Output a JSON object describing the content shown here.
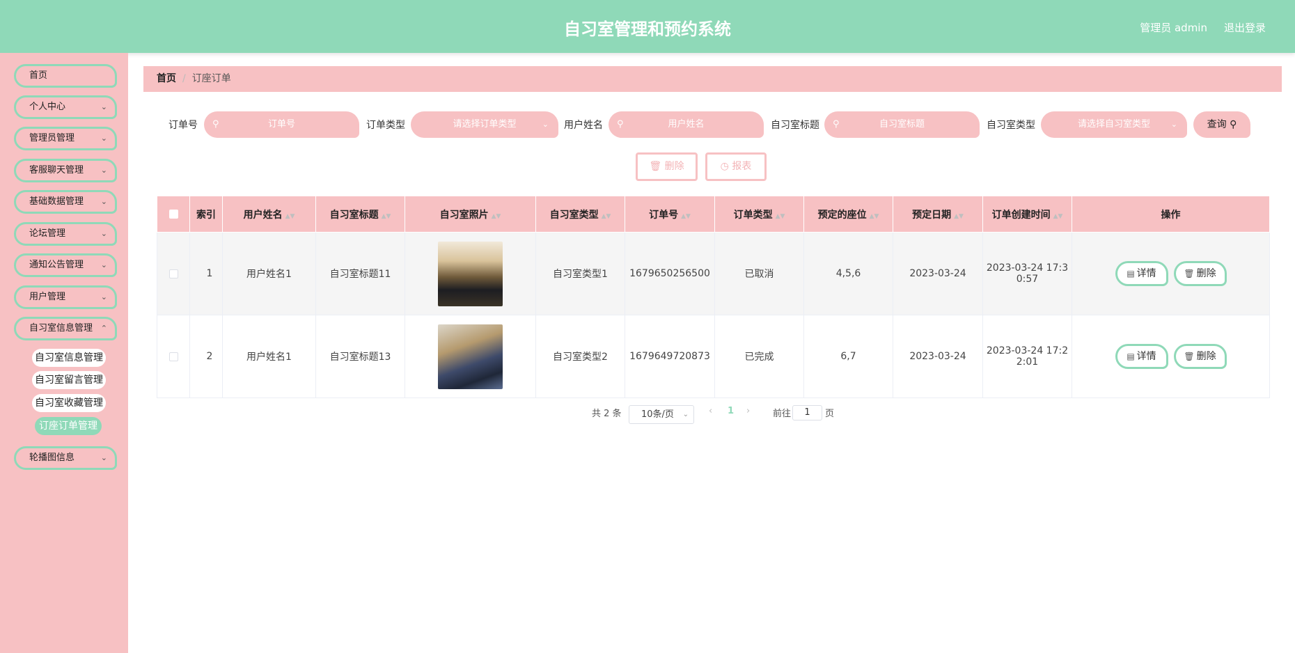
{
  "header": {
    "title": "自习室管理和预约系统",
    "user": "管理员 admin",
    "logout": "退出登录"
  },
  "sidebar": {
    "items": [
      {
        "label": "首页"
      },
      {
        "label": "个人中心"
      },
      {
        "label": "管理员管理"
      },
      {
        "label": "客服聊天管理"
      },
      {
        "label": "基础数据管理"
      },
      {
        "label": "论坛管理"
      },
      {
        "label": "通知公告管理"
      },
      {
        "label": "用户管理"
      },
      {
        "label": "自习室信息管理"
      },
      {
        "label": "轮播图信息"
      }
    ],
    "sub_items": [
      {
        "label": "自习室信息管理"
      },
      {
        "label": "自习室留言管理"
      },
      {
        "label": "自习室收藏管理"
      },
      {
        "label": "订座订单管理"
      }
    ]
  },
  "breadcrumb": {
    "home": "首页",
    "separator": "/",
    "current": "订座订单"
  },
  "filters": {
    "order_no": {
      "label": "订单号",
      "placeholder": "订单号"
    },
    "order_type": {
      "label": "订单类型",
      "placeholder": "请选择订单类型"
    },
    "user_name": {
      "label": "用户姓名",
      "placeholder": "用户姓名"
    },
    "room_title": {
      "label": "自习室标题",
      "placeholder": "自习室标题"
    },
    "room_type": {
      "label": "自习室类型",
      "placeholder": "请选择自习室类型"
    },
    "query_label": "查询"
  },
  "actions": {
    "delete_label": "删除",
    "report_label": "报表"
  },
  "table": {
    "columns": [
      "索引",
      "用户姓名",
      "自习室标题",
      "自习室照片",
      "自习室类型",
      "订单号",
      "订单类型",
      "预定的座位",
      "预定日期",
      "订单创建时间",
      "操作"
    ],
    "rows": [
      {
        "index": "1",
        "user_name": "用户姓名1",
        "room_title": "自习室标题11",
        "room_type": "自习室类型1",
        "order_no": "1679650256500",
        "order_type": "已取消",
        "seats": "4,5,6",
        "date": "2023-03-24",
        "created_line1": "2023-03-24 17:3",
        "created_line2": "0:57"
      },
      {
        "index": "2",
        "user_name": "用户姓名1",
        "room_title": "自习室标题13",
        "room_type": "自习室类型2",
        "order_no": "1679649720873",
        "order_type": "已完成",
        "seats": "6,7",
        "date": "2023-03-24",
        "created_line1": "2023-03-24 17:2",
        "created_line2": "2:01"
      }
    ],
    "detail_label": "详情",
    "delete_label": "删除"
  },
  "pagination": {
    "total": "共 2 条",
    "page_size": "10条/页",
    "current_page": "1",
    "goto_prefix": "前往",
    "goto_value": "1",
    "goto_suffix": "页"
  },
  "colors": {
    "header": "#8fd9b8",
    "pink": "#f7c1c3",
    "accent": "#8fd9b8"
  }
}
